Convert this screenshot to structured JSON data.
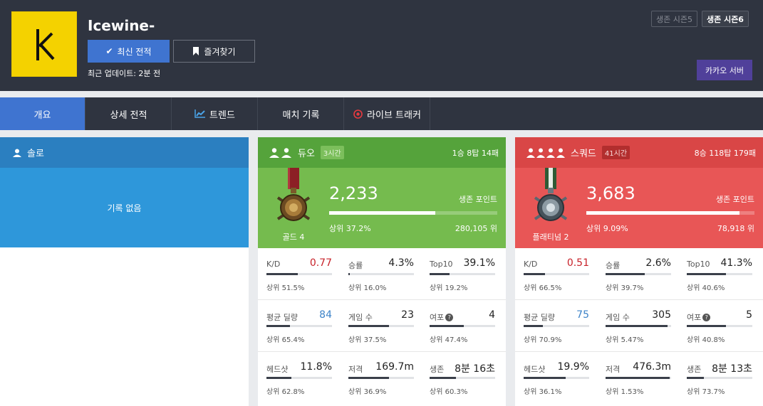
{
  "player": {
    "name": "Icewine-",
    "update_button": "최신 전적",
    "favorite_button": "즐겨찾기",
    "last_update": "최근 업데이트: 2분 전"
  },
  "seasons": [
    "생존 시즌5",
    "생존 시즌6"
  ],
  "server_button": "카카오 서버",
  "tabs": [
    "개요",
    "상세 전적",
    "트렌드",
    "매치 기록",
    "라이브 트래커"
  ],
  "solo": {
    "title": "솔로",
    "empty": "기록 없음"
  },
  "duo": {
    "title": "듀오",
    "badge": "3시간",
    "record": "1승 8탑 14패",
    "tier": "골드 4",
    "rp": "2,233",
    "rp_label": "생존 포인트",
    "top": "상위 37.2%",
    "rank": "280,105 위",
    "progress": 0.63,
    "stats": [
      {
        "label": "K/D",
        "value": "0.77",
        "pct": "상위 51.5%",
        "fill": 0.48
      },
      {
        "label": "승률",
        "value": "4.3%",
        "pct": "상위 16.0%",
        "fill": 0.02
      },
      {
        "label": "Top10",
        "value": "39.1%",
        "pct": "상위 19.2%",
        "fill": 0.3
      },
      {
        "label": "평균 딜량",
        "value": "84",
        "pct": "상위 65.4%",
        "fill": 0.36
      },
      {
        "label": "게임 수",
        "value": "23",
        "pct": "상위 37.5%",
        "fill": 0.62
      },
      {
        "label": "여포",
        "value": "4",
        "pct": "상위 47.4%",
        "fill": 0.52
      },
      {
        "label": "헤드샷",
        "value": "11.8%",
        "pct": "상위 62.8%",
        "fill": 0.38
      },
      {
        "label": "저격",
        "value": "169.7m",
        "pct": "상위 36.9%",
        "fill": 0.62
      },
      {
        "label": "생존",
        "value": "8분 16초",
        "pct": "상위 60.3%",
        "fill": 0.4
      }
    ]
  },
  "squad": {
    "title": "스쿼드",
    "badge": "41시간",
    "record": "8승 118탑 179패",
    "tier": "플래티넘 2",
    "rp": "3,683",
    "rp_label": "생존 포인트",
    "top": "상위 9.09%",
    "rank": "78,918 위",
    "progress": 0.91,
    "stats": [
      {
        "label": "K/D",
        "value": "0.51",
        "pct": "상위 66.5%",
        "fill": 0.33
      },
      {
        "label": "승률",
        "value": "2.6%",
        "pct": "상위 39.7%",
        "fill": 0.6
      },
      {
        "label": "Top10",
        "value": "41.3%",
        "pct": "상위 40.6%",
        "fill": 0.6
      },
      {
        "label": "평균 딜량",
        "value": "75",
        "pct": "상위 70.9%",
        "fill": 0.29
      },
      {
        "label": "게임 수",
        "value": "305",
        "pct": "상위 5.47%",
        "fill": 0.95
      },
      {
        "label": "여포",
        "value": "5",
        "pct": "상위 40.8%",
        "fill": 0.6
      },
      {
        "label": "헤드샷",
        "value": "19.9%",
        "pct": "상위 36.1%",
        "fill": 0.64
      },
      {
        "label": "저격",
        "value": "476.3m",
        "pct": "상위 1.53%",
        "fill": 0.98
      },
      {
        "label": "생존",
        "value": "8분 13초",
        "pct": "상위 73.7%",
        "fill": 0.26
      }
    ]
  },
  "colors": {
    "header_bg": "#2f3440",
    "accent": "#3f74d0",
    "duo": "#75bb4e",
    "squad": "#e85656",
    "solo": "#2e97da"
  }
}
